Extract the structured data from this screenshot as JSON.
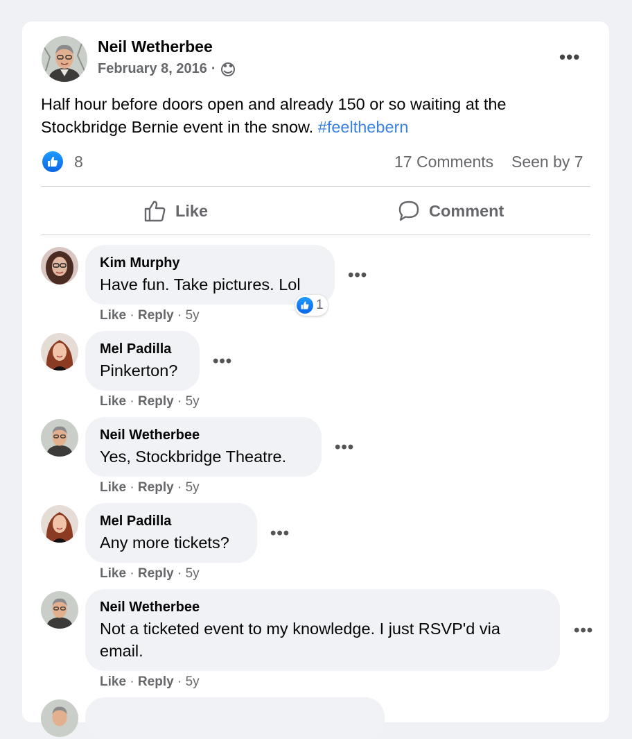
{
  "post": {
    "author": "Neil Wetherbee",
    "date": "February 8, 2016",
    "separator": "·",
    "audience_icon": "friends-icon",
    "more_label": "•••",
    "text_main": "Half hour before doors open and already 150 or so waiting at the Stockbridge Bernie event in the snow. ",
    "hashtag": "#feelthebern",
    "likes_count": "8",
    "comments_count": "17 Comments",
    "seen_by": "Seen by 7",
    "like_label": "Like",
    "comment_label": "Comment"
  },
  "comments": [
    {
      "name": "Kim Murphy",
      "text": "Have fun. Take pictures. Lol",
      "like": "Like",
      "sep1": "·",
      "reply": "Reply",
      "sep2": "·",
      "age": "5y",
      "dots": "•••",
      "reactions": "1"
    },
    {
      "name": "Mel Padilla",
      "text": "Pinkerton?",
      "like": "Like",
      "sep1": "·",
      "reply": "Reply",
      "sep2": "·",
      "age": "5y",
      "dots": "•••"
    },
    {
      "name": "Neil Wetherbee",
      "text": "Yes, Stockbridge Theatre.",
      "like": "Like",
      "sep1": "·",
      "reply": "Reply",
      "sep2": "·",
      "age": "5y",
      "dots": "•••"
    },
    {
      "name": "Mel Padilla",
      "text": "Any more tickets?",
      "like": "Like",
      "sep1": "·",
      "reply": "Reply",
      "sep2": "·",
      "age": "5y",
      "dots": "•••"
    },
    {
      "name": "Neil Wetherbee",
      "text_line1": "Not a ticketed event to my knowledge. I just RSVP'd via",
      "text_line2": "email.",
      "like": "Like",
      "sep1": "·",
      "reply": "Reply",
      "sep2": "·",
      "age": "5y",
      "dots": "•••"
    }
  ],
  "colors": {
    "accent": "#1877f2",
    "hashtag": "#3b82e0",
    "bubble": "#f0f2f5",
    "meta": "#65676b"
  }
}
